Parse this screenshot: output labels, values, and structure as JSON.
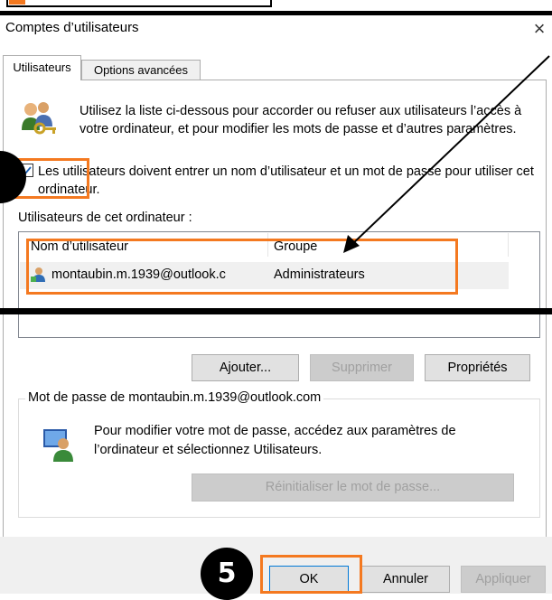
{
  "window": {
    "title": "Comptes d’utilisateurs",
    "close_glyph": "×"
  },
  "tabs": [
    {
      "label": "Utilisateurs",
      "active": true
    },
    {
      "label": "Options avancées",
      "active": false
    }
  ],
  "users_tab": {
    "info_text": "Utilisez la liste ci-dessous pour accorder ou refuser aux utilisateurs l’accès à votre ordinateur, et pour modifier les mots de passe et d’autres paramètres.",
    "require_login_checkbox": {
      "checked": true,
      "label": "Les utilisateurs doivent entrer un nom d’utilisateur et un mot de passe pour utiliser cet ordinateur."
    },
    "users_list_label": "Utilisateurs de cet ordinateur :",
    "columns": [
      "Nom d’utilisateur",
      "Groupe"
    ],
    "rows": [
      {
        "user": "montaubin.m.1939@outlook.c",
        "group": "Administrateurs"
      }
    ],
    "buttons": {
      "add": "Ajouter...",
      "remove": "Supprimer",
      "properties": "Propriétés"
    },
    "password_group": {
      "title": "Mot de passe de montaubin.m.1939@outlook.com",
      "text": "Pour modifier votre mot de passe, accédez aux paramètres de l’ordinateur et sélectionnez Utilisateurs.",
      "reset_button": "Réinitialiser le mot de passe..."
    }
  },
  "footer": {
    "ok": "OK",
    "cancel": "Annuler",
    "apply": "Appliquer"
  },
  "annotations": {
    "step_badge": "5",
    "highlight_color": "#f47920"
  }
}
